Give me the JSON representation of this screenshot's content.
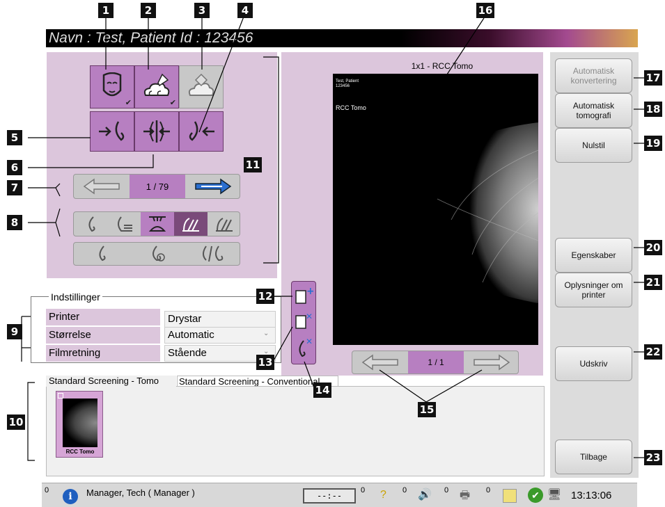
{
  "titlebar": {
    "text": "Navn : Test, Patient    Id : 123456"
  },
  "callouts": [
    "1",
    "2",
    "3",
    "4",
    "5",
    "6",
    "7",
    "8",
    "9",
    "10",
    "11",
    "12",
    "13",
    "14",
    "15",
    "16",
    "17",
    "18",
    "19",
    "20",
    "21",
    "22",
    "23"
  ],
  "navigation": {
    "page": "1 / 79"
  },
  "settings": {
    "title": "Indstillinger",
    "rows": [
      {
        "label": "Printer",
        "value": "Drystar"
      },
      {
        "label": "Størrelse",
        "value": "Automatic"
      },
      {
        "label": "Filmretning",
        "value": "Stående"
      }
    ]
  },
  "tabs": [
    "Standard Screening - Tomo",
    "Standard Screening - Conventional"
  ],
  "thumbnail": {
    "label": "RCC Tomo"
  },
  "image": {
    "header": "1x1 - RCC Tomo",
    "overlay_lines": [
      "Test, Patient",
      "123456",
      "RCC Tomo"
    ],
    "page": "1 / 1"
  },
  "side_buttons": {
    "auto_convert": "Automatisk konvertering",
    "auto_tomo": "Automatisk tomografi",
    "reset": "Nulstil",
    "properties": "Egenskaber",
    "printer_info": "Oplysninger om printer",
    "print": "Udskriv",
    "back": "Tilbage"
  },
  "status": {
    "count1": "0",
    "user": "Manager, Tech ( Manager )",
    "count2": "0",
    "count3": "0",
    "count4": "0",
    "count5": "0",
    "clock": "13:13:06",
    "display": "--:--"
  },
  "colors": {
    "panel": "#dcc6dc",
    "tile": "#b77fc1",
    "highlight": "#f2ef00",
    "nav_blue": "#2a6fd1"
  }
}
